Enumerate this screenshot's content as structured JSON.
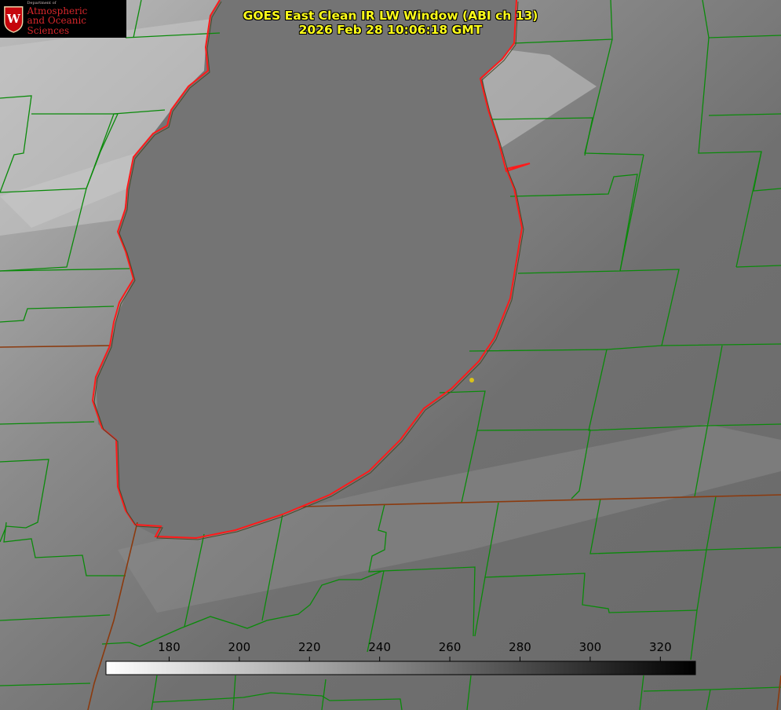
{
  "header": {
    "title": "GOES East Clean IR LW Window (ABI ch 13)",
    "timestamp": "2026 Feb 28 10:06:18 GMT"
  },
  "logo": {
    "dept": "Department of",
    "line1": "Atmospheric",
    "line2": "and Oceanic Sciences",
    "brand_color": "#c5050c"
  },
  "colorbar": {
    "ticks": [
      "180",
      "200",
      "220",
      "240",
      "260",
      "280",
      "300",
      "320"
    ],
    "tick_values": [
      180,
      200,
      220,
      240,
      260,
      280,
      300,
      320
    ],
    "range": [
      162,
      330
    ],
    "gradient": [
      "#ffffff",
      "#000000"
    ]
  },
  "map_colors": {
    "county_lines": "#0a8a0a",
    "state_lines": "#8b3a0e",
    "shoreline": "#ff1a1a",
    "station_marker": "#d9c21a"
  }
}
